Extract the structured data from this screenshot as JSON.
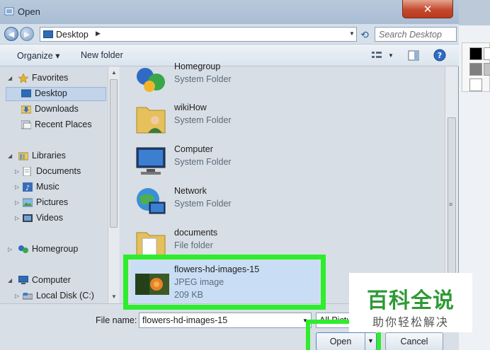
{
  "window": {
    "title": "Open",
    "close_glyph": "✕"
  },
  "nav": {
    "address_segment": "Desktop",
    "search_placeholder": "Search Desktop"
  },
  "toolbar": {
    "organize": "Organize ▾",
    "new_folder": "New folder"
  },
  "navpane": {
    "favorites": "Favorites",
    "desktop": "Desktop",
    "downloads": "Downloads",
    "recent": "Recent Places",
    "libraries": "Libraries",
    "documents": "Documents",
    "music": "Music",
    "pictures": "Pictures",
    "videos": "Videos",
    "homegroup": "Homegroup",
    "computer": "Computer",
    "local_disk": "Local Disk (C:)"
  },
  "files": [
    {
      "name": "Homegroup",
      "type": "System Folder",
      "icon": "homegroup-icon"
    },
    {
      "name": "wikiHow",
      "type": "System Folder",
      "icon": "user-folder-icon"
    },
    {
      "name": "Computer",
      "type": "System Folder",
      "icon": "computer-icon"
    },
    {
      "name": "Network",
      "type": "System Folder",
      "icon": "network-icon"
    },
    {
      "name": "documents",
      "type": "File folder",
      "icon": "folder-icon"
    },
    {
      "name": "flowers-hd-images-15",
      "type": "JPEG image",
      "size": "209 KB",
      "icon": "image-thumbnail"
    }
  ],
  "footer": {
    "file_name_label": "File name:",
    "file_name_value": "flowers-hd-images-15",
    "filter_value": "All Pictu",
    "open_label": "Open",
    "cancel_label": "Cancel"
  },
  "watermark": {
    "main": "百科全说",
    "sub": "助你轻松解决"
  },
  "colors": {
    "highlight": "#2ded2d",
    "selection": "#c9def5",
    "accent": "#2e9a36"
  }
}
